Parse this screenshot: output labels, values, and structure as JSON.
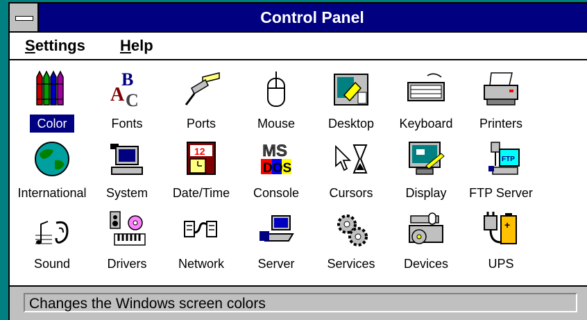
{
  "window": {
    "title": "Control Panel"
  },
  "menubar": {
    "items": [
      {
        "first": "S",
        "rest": "ettings"
      },
      {
        "first": "H",
        "rest": "elp"
      }
    ]
  },
  "icons": [
    {
      "label": "Color",
      "icon": "color-crayons-icon",
      "selected": true
    },
    {
      "label": "Fonts",
      "icon": "fonts-icon"
    },
    {
      "label": "Ports",
      "icon": "ports-icon"
    },
    {
      "label": "Mouse",
      "icon": "mouse-icon"
    },
    {
      "label": "Desktop",
      "icon": "desktop-icon"
    },
    {
      "label": "Keyboard",
      "icon": "keyboard-icon"
    },
    {
      "label": "Printers",
      "icon": "printer-icon"
    },
    {
      "label": "International",
      "icon": "globe-icon"
    },
    {
      "label": "System",
      "icon": "computer-icon"
    },
    {
      "label": "Date/Time",
      "icon": "calendar-clock-icon"
    },
    {
      "label": "Console",
      "icon": "ms-dos-icon"
    },
    {
      "label": "Cursors",
      "icon": "cursor-hourglass-icon"
    },
    {
      "label": "Display",
      "icon": "monitor-icon"
    },
    {
      "label": "FTP Server",
      "icon": "ftp-server-icon"
    },
    {
      "label": "Sound",
      "icon": "sound-icon"
    },
    {
      "label": "Drivers",
      "icon": "drivers-icon"
    },
    {
      "label": "Network",
      "icon": "network-icon"
    },
    {
      "label": "Server",
      "icon": "server-icon"
    },
    {
      "label": "Services",
      "icon": "gears-icon"
    },
    {
      "label": "Devices",
      "icon": "devices-icon"
    },
    {
      "label": "UPS",
      "icon": "ups-battery-icon"
    }
  ],
  "status": {
    "text": "Changes the Windows screen colors"
  },
  "colors": {
    "titlebar": "#000080",
    "desktop": "#008080",
    "selection": "#000080"
  }
}
